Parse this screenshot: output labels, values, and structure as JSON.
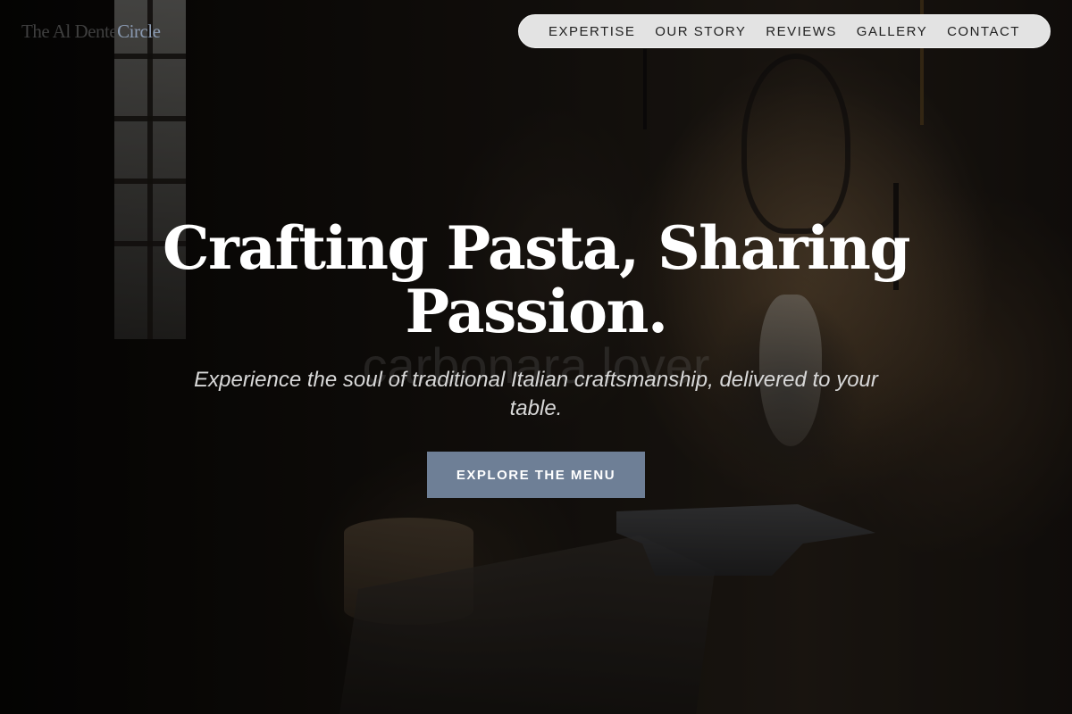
{
  "brand": {
    "name_main": "The Al Dente",
    "name_accent": "Circle",
    "accent_color": "#8a9ab1"
  },
  "nav": {
    "items": [
      {
        "label": "EXPERTISE"
      },
      {
        "label": "OUR STORY"
      },
      {
        "label": "REVIEWS"
      },
      {
        "label": "GALLERY"
      },
      {
        "label": "CONTACT"
      }
    ]
  },
  "hero": {
    "headline": "Crafting Pasta, Sharing Passion.",
    "ghost_text": "carbonara lover",
    "subheadline": "Experience the soul of traditional Italian craftsmanship, delivered to your table.",
    "cta_label": "EXPLORE THE MENU",
    "cta_color": "#6e7f96",
    "background_image": "blacksmith-workshop"
  }
}
